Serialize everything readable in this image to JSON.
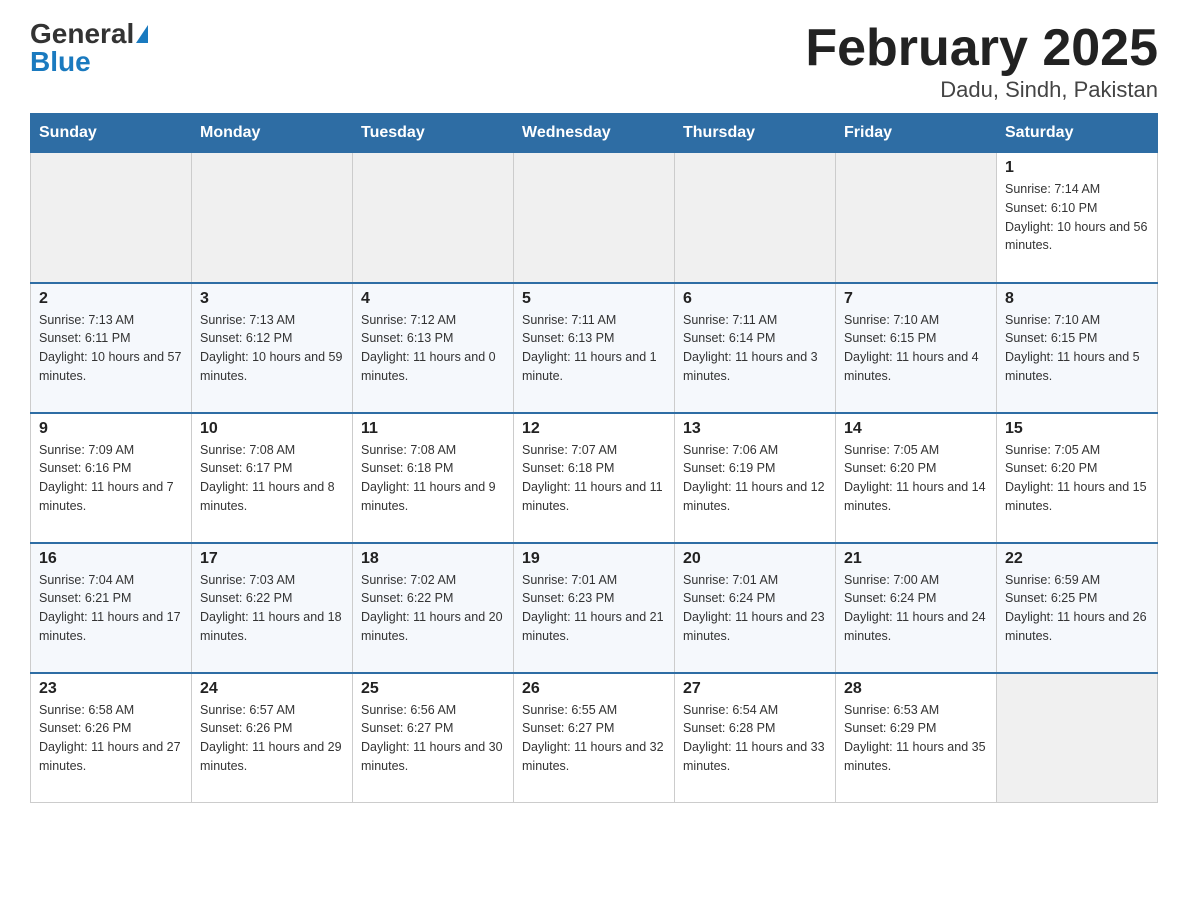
{
  "header": {
    "logo_general": "General",
    "logo_blue": "Blue",
    "title": "February 2025",
    "subtitle": "Dadu, Sindh, Pakistan"
  },
  "days_of_week": [
    "Sunday",
    "Monday",
    "Tuesday",
    "Wednesday",
    "Thursday",
    "Friday",
    "Saturday"
  ],
  "weeks": [
    [
      {
        "day": "",
        "sunrise": "",
        "sunset": "",
        "daylight": "",
        "empty": true
      },
      {
        "day": "",
        "sunrise": "",
        "sunset": "",
        "daylight": "",
        "empty": true
      },
      {
        "day": "",
        "sunrise": "",
        "sunset": "",
        "daylight": "",
        "empty": true
      },
      {
        "day": "",
        "sunrise": "",
        "sunset": "",
        "daylight": "",
        "empty": true
      },
      {
        "day": "",
        "sunrise": "",
        "sunset": "",
        "daylight": "",
        "empty": true
      },
      {
        "day": "",
        "sunrise": "",
        "sunset": "",
        "daylight": "",
        "empty": true
      },
      {
        "day": "1",
        "sunrise": "Sunrise: 7:14 AM",
        "sunset": "Sunset: 6:10 PM",
        "daylight": "Daylight: 10 hours and 56 minutes.",
        "empty": false
      }
    ],
    [
      {
        "day": "2",
        "sunrise": "Sunrise: 7:13 AM",
        "sunset": "Sunset: 6:11 PM",
        "daylight": "Daylight: 10 hours and 57 minutes.",
        "empty": false
      },
      {
        "day": "3",
        "sunrise": "Sunrise: 7:13 AM",
        "sunset": "Sunset: 6:12 PM",
        "daylight": "Daylight: 10 hours and 59 minutes.",
        "empty": false
      },
      {
        "day": "4",
        "sunrise": "Sunrise: 7:12 AM",
        "sunset": "Sunset: 6:13 PM",
        "daylight": "Daylight: 11 hours and 0 minutes.",
        "empty": false
      },
      {
        "day": "5",
        "sunrise": "Sunrise: 7:11 AM",
        "sunset": "Sunset: 6:13 PM",
        "daylight": "Daylight: 11 hours and 1 minute.",
        "empty": false
      },
      {
        "day": "6",
        "sunrise": "Sunrise: 7:11 AM",
        "sunset": "Sunset: 6:14 PM",
        "daylight": "Daylight: 11 hours and 3 minutes.",
        "empty": false
      },
      {
        "day": "7",
        "sunrise": "Sunrise: 7:10 AM",
        "sunset": "Sunset: 6:15 PM",
        "daylight": "Daylight: 11 hours and 4 minutes.",
        "empty": false
      },
      {
        "day": "8",
        "sunrise": "Sunrise: 7:10 AM",
        "sunset": "Sunset: 6:15 PM",
        "daylight": "Daylight: 11 hours and 5 minutes.",
        "empty": false
      }
    ],
    [
      {
        "day": "9",
        "sunrise": "Sunrise: 7:09 AM",
        "sunset": "Sunset: 6:16 PM",
        "daylight": "Daylight: 11 hours and 7 minutes.",
        "empty": false
      },
      {
        "day": "10",
        "sunrise": "Sunrise: 7:08 AM",
        "sunset": "Sunset: 6:17 PM",
        "daylight": "Daylight: 11 hours and 8 minutes.",
        "empty": false
      },
      {
        "day": "11",
        "sunrise": "Sunrise: 7:08 AM",
        "sunset": "Sunset: 6:18 PM",
        "daylight": "Daylight: 11 hours and 9 minutes.",
        "empty": false
      },
      {
        "day": "12",
        "sunrise": "Sunrise: 7:07 AM",
        "sunset": "Sunset: 6:18 PM",
        "daylight": "Daylight: 11 hours and 11 minutes.",
        "empty": false
      },
      {
        "day": "13",
        "sunrise": "Sunrise: 7:06 AM",
        "sunset": "Sunset: 6:19 PM",
        "daylight": "Daylight: 11 hours and 12 minutes.",
        "empty": false
      },
      {
        "day": "14",
        "sunrise": "Sunrise: 7:05 AM",
        "sunset": "Sunset: 6:20 PM",
        "daylight": "Daylight: 11 hours and 14 minutes.",
        "empty": false
      },
      {
        "day": "15",
        "sunrise": "Sunrise: 7:05 AM",
        "sunset": "Sunset: 6:20 PM",
        "daylight": "Daylight: 11 hours and 15 minutes.",
        "empty": false
      }
    ],
    [
      {
        "day": "16",
        "sunrise": "Sunrise: 7:04 AM",
        "sunset": "Sunset: 6:21 PM",
        "daylight": "Daylight: 11 hours and 17 minutes.",
        "empty": false
      },
      {
        "day": "17",
        "sunrise": "Sunrise: 7:03 AM",
        "sunset": "Sunset: 6:22 PM",
        "daylight": "Daylight: 11 hours and 18 minutes.",
        "empty": false
      },
      {
        "day": "18",
        "sunrise": "Sunrise: 7:02 AM",
        "sunset": "Sunset: 6:22 PM",
        "daylight": "Daylight: 11 hours and 20 minutes.",
        "empty": false
      },
      {
        "day": "19",
        "sunrise": "Sunrise: 7:01 AM",
        "sunset": "Sunset: 6:23 PM",
        "daylight": "Daylight: 11 hours and 21 minutes.",
        "empty": false
      },
      {
        "day": "20",
        "sunrise": "Sunrise: 7:01 AM",
        "sunset": "Sunset: 6:24 PM",
        "daylight": "Daylight: 11 hours and 23 minutes.",
        "empty": false
      },
      {
        "day": "21",
        "sunrise": "Sunrise: 7:00 AM",
        "sunset": "Sunset: 6:24 PM",
        "daylight": "Daylight: 11 hours and 24 minutes.",
        "empty": false
      },
      {
        "day": "22",
        "sunrise": "Sunrise: 6:59 AM",
        "sunset": "Sunset: 6:25 PM",
        "daylight": "Daylight: 11 hours and 26 minutes.",
        "empty": false
      }
    ],
    [
      {
        "day": "23",
        "sunrise": "Sunrise: 6:58 AM",
        "sunset": "Sunset: 6:26 PM",
        "daylight": "Daylight: 11 hours and 27 minutes.",
        "empty": false
      },
      {
        "day": "24",
        "sunrise": "Sunrise: 6:57 AM",
        "sunset": "Sunset: 6:26 PM",
        "daylight": "Daylight: 11 hours and 29 minutes.",
        "empty": false
      },
      {
        "day": "25",
        "sunrise": "Sunrise: 6:56 AM",
        "sunset": "Sunset: 6:27 PM",
        "daylight": "Daylight: 11 hours and 30 minutes.",
        "empty": false
      },
      {
        "day": "26",
        "sunrise": "Sunrise: 6:55 AM",
        "sunset": "Sunset: 6:27 PM",
        "daylight": "Daylight: 11 hours and 32 minutes.",
        "empty": false
      },
      {
        "day": "27",
        "sunrise": "Sunrise: 6:54 AM",
        "sunset": "Sunset: 6:28 PM",
        "daylight": "Daylight: 11 hours and 33 minutes.",
        "empty": false
      },
      {
        "day": "28",
        "sunrise": "Sunrise: 6:53 AM",
        "sunset": "Sunset: 6:29 PM",
        "daylight": "Daylight: 11 hours and 35 minutes.",
        "empty": false
      },
      {
        "day": "",
        "sunrise": "",
        "sunset": "",
        "daylight": "",
        "empty": true
      }
    ]
  ]
}
